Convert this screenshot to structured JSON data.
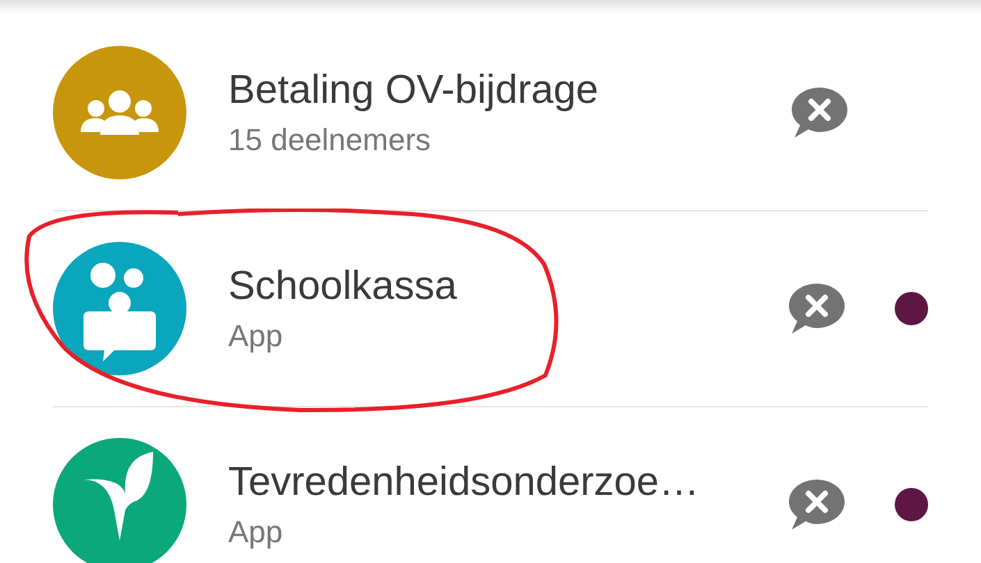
{
  "conversations": [
    {
      "kind": "group",
      "color": "#c8960c",
      "title": "Betaling OV-bijdrage",
      "subtitle": "15 deelnemers",
      "unread": false
    },
    {
      "kind": "chat",
      "color": "#0aa6bd",
      "title": "Schoolkassa",
      "subtitle": "App",
      "unread": true
    },
    {
      "kind": "leaf",
      "color": "#0aa87a",
      "title": "Tevredenheidsonderzoe…",
      "subtitle": "App",
      "unread": true
    }
  ]
}
